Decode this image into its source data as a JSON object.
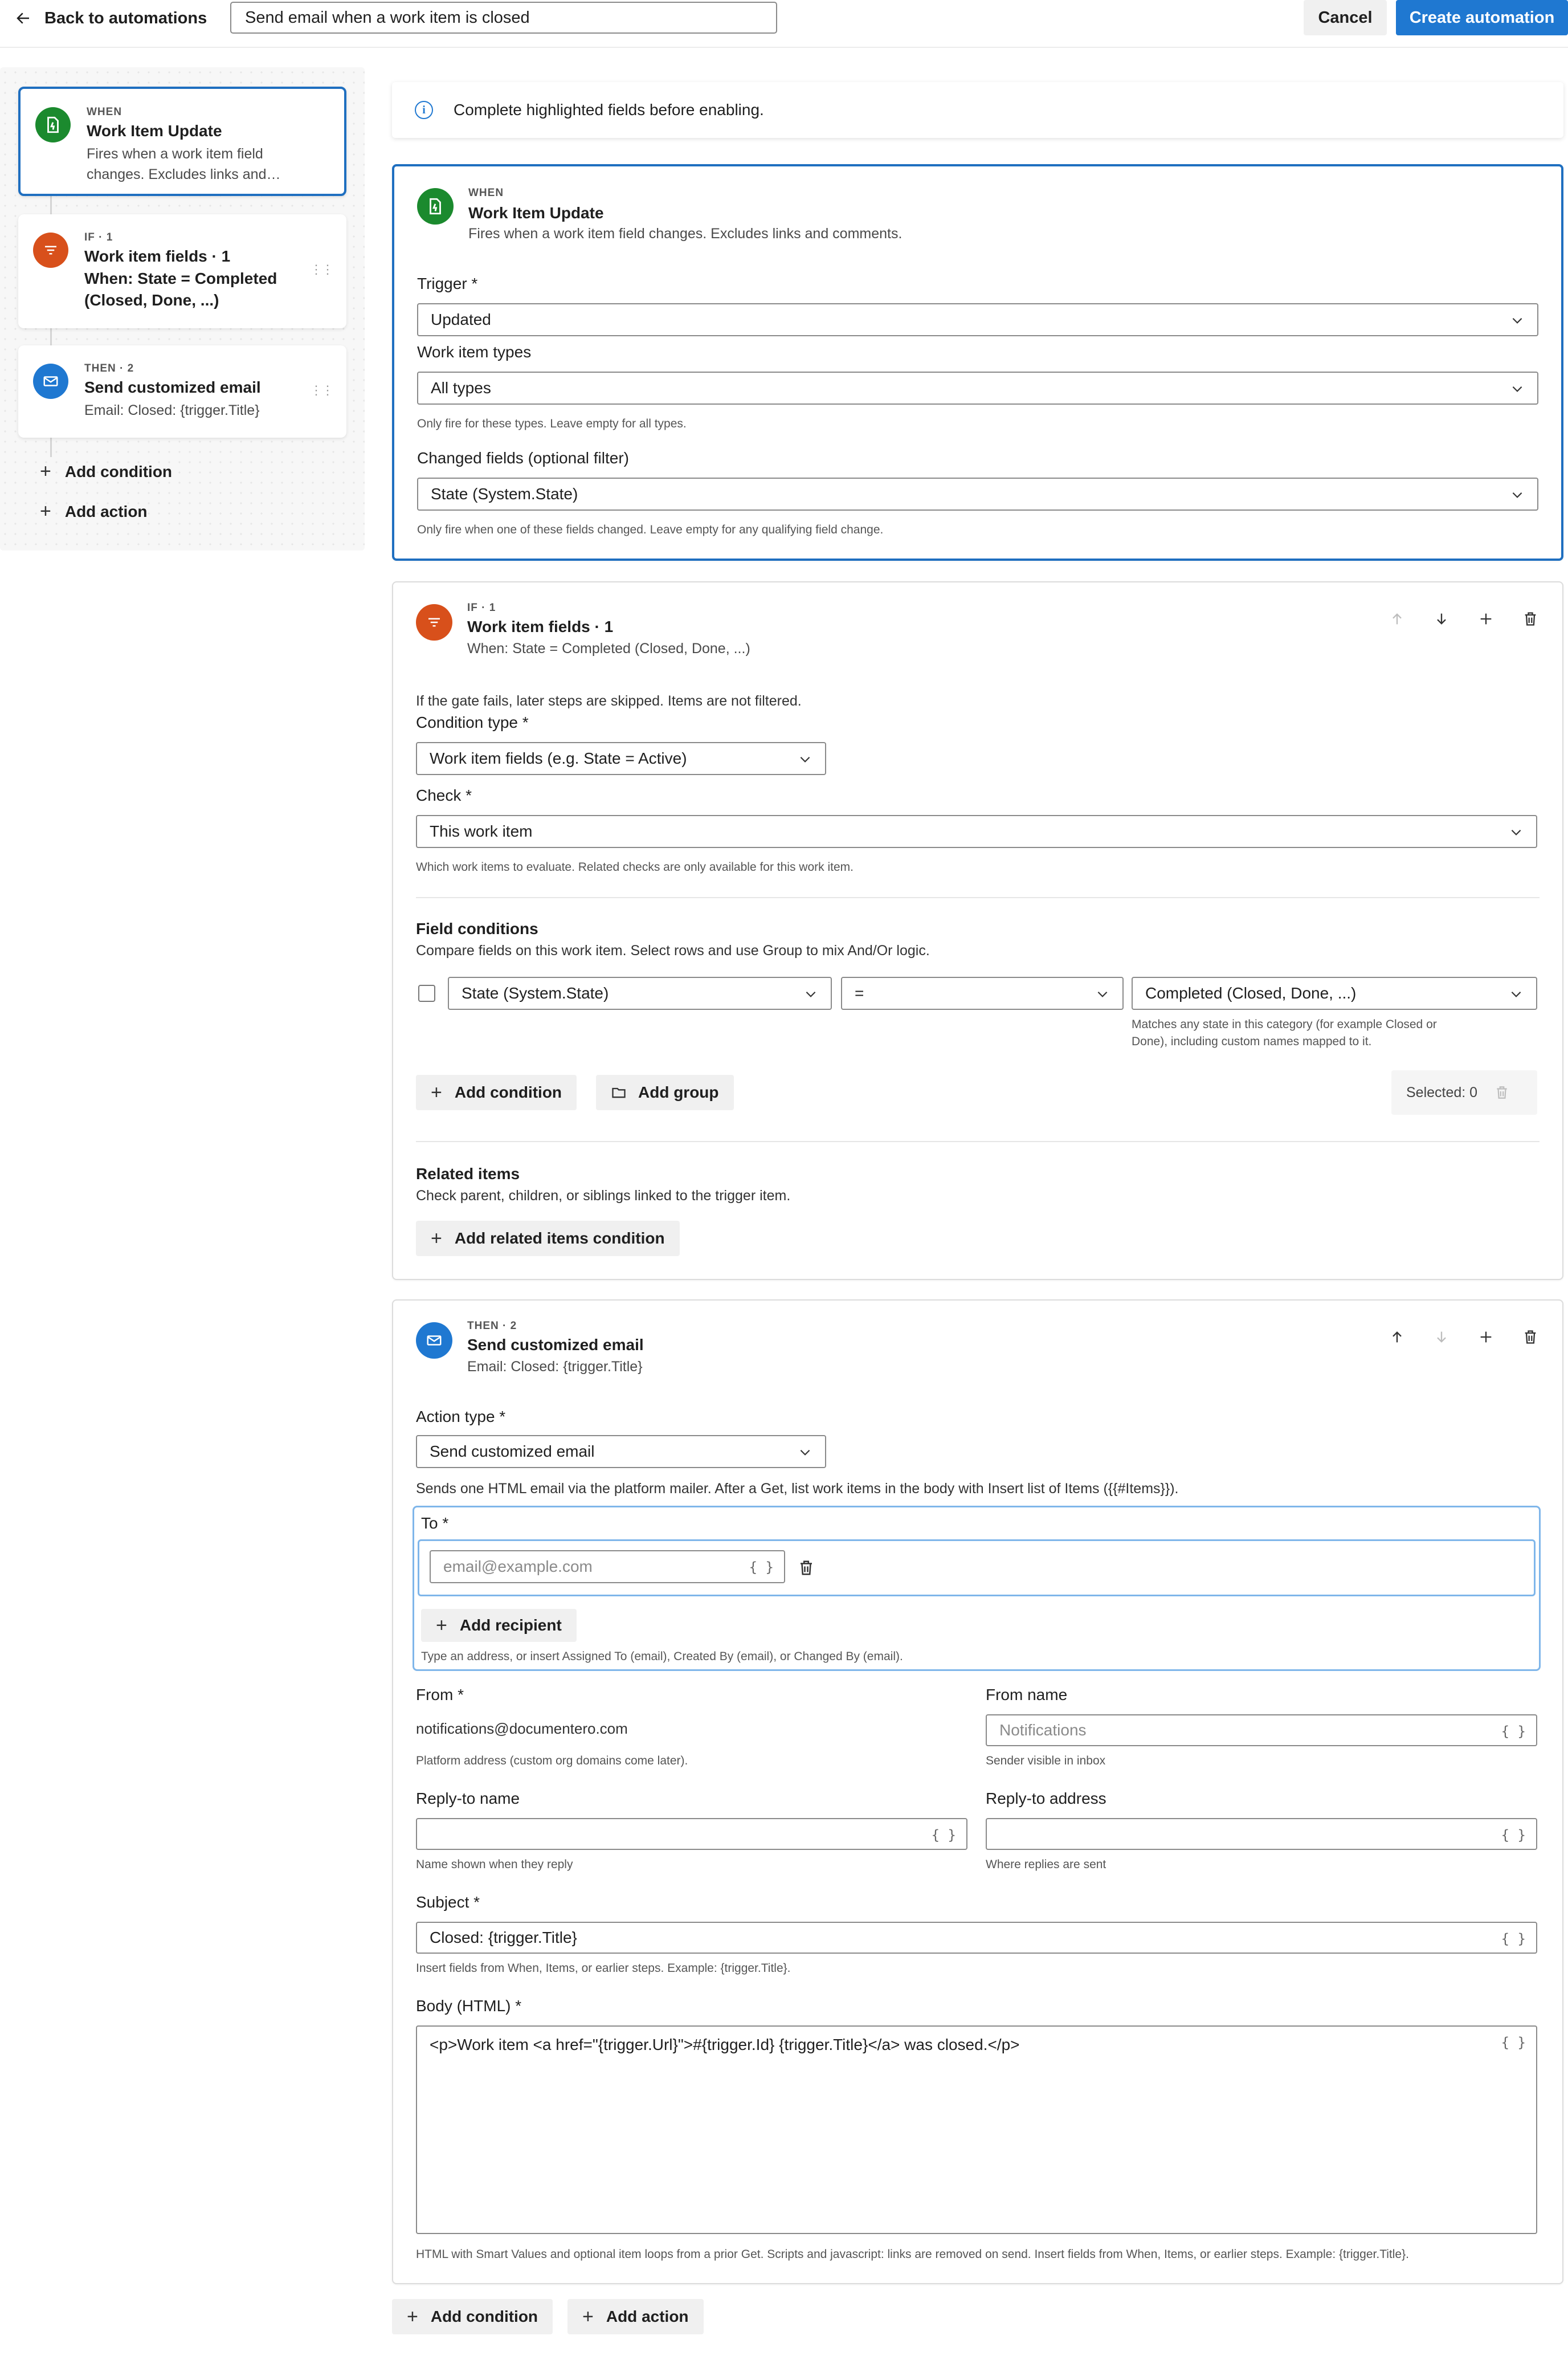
{
  "topbar": {
    "back_label": "Back to automations",
    "automation_name": "Send email when a work item is closed",
    "cancel_label": "Cancel",
    "create_label": "Create automation"
  },
  "rail": {
    "when_card": {
      "kicker": "WHEN",
      "title": "Work Item Update",
      "desc_line1": "Fires when a work item field",
      "desc_line2": "changes. Excludes links and…"
    },
    "if_card": {
      "kicker": "IF · 1",
      "title": "Work item fields · 1",
      "cond_line1": "When: State = Completed",
      "cond_line2": "(Closed, Done, ...)"
    },
    "then_card": {
      "kicker": "THEN · 2",
      "title": "Send customized email",
      "desc": "Email: Closed: {trigger.Title}"
    },
    "add_condition": "Add condition",
    "add_action": "Add action"
  },
  "banner": {
    "text": "Complete highlighted fields before enabling."
  },
  "when_section": {
    "kicker": "WHEN",
    "title": "Work Item Update",
    "desc": "Fires when a work item field changes. Excludes links and comments.",
    "trigger_label": "Trigger *",
    "trigger_value": "Updated",
    "types_label": "Work item types",
    "types_value": "All types",
    "types_help": "Only fire for these types. Leave empty for all types.",
    "changed_label": "Changed fields (optional filter)",
    "changed_value": "State (System.State)",
    "changed_help": "Only fire when one of these fields changed. Leave empty for any qualifying field change."
  },
  "if_section": {
    "kicker": "IF · 1",
    "title": "Work item fields · 1",
    "desc": "When: State = Completed (Closed, Done, ...)",
    "gate_note": "If the gate fails, later steps are skipped. Items are not filtered.",
    "condition_type_label": "Condition type *",
    "condition_type_value": "Work item fields (e.g. State = Active)",
    "check_label": "Check *",
    "check_value": "This work item",
    "check_help": "Which work items to evaluate. Related checks are only available for this work item.",
    "field_conditions_title": "Field conditions",
    "field_conditions_desc": "Compare fields on this work item. Select rows and use Group to mix And/Or logic.",
    "row_field": "State (System.State)",
    "row_operator": "=",
    "row_value": "Completed (Closed, Done, ...)",
    "row_help_line1": "Matches any state in this category (for example Closed or",
    "row_help_line2": "Done), including custom names mapped to it.",
    "add_condition": "Add condition",
    "add_group": "Add group",
    "selected": "Selected: 0",
    "related_title": "Related items",
    "related_desc": "Check parent, children, or siblings linked to the trigger item.",
    "add_related": "Add related items condition"
  },
  "then_section": {
    "kicker": "THEN · 2",
    "title": "Send customized email",
    "desc": "Email: Closed: {trigger.Title}",
    "action_type_label": "Action type *",
    "action_type_value": "Send customized email",
    "action_desc": "Sends one HTML email via the platform mailer. After a Get, list work items in the body with Insert list of Items ({{#Items}}).",
    "to_label": "To *",
    "to_placeholder": "email@example.com",
    "add_recipient": "Add recipient",
    "to_help": "Type an address, or insert Assigned To (email), Created By (email), or Changed By (email).",
    "from_label": "From *",
    "from_value": "notifications@documentero.com",
    "from_help": "Platform address (custom org domains come later).",
    "from_name_label": "From name",
    "from_name_placeholder": "Notifications",
    "from_name_help": "Sender visible in inbox",
    "reply_name_label": "Reply-to name",
    "reply_name_help": "Name shown when they reply",
    "reply_addr_label": "Reply-to address",
    "reply_addr_help": "Where replies are sent",
    "subject_label": "Subject *",
    "subject_value": "Closed: {trigger.Title}",
    "subject_help": "Insert fields from When, Items, or earlier steps. Example: {trigger.Title}.",
    "body_label": "Body (HTML) *",
    "body_value": "<p>Work item <a href=\"{trigger.Url}\">#{trigger.Id} {trigger.Title}</a> was closed.</p>",
    "body_help": "HTML with Smart Values and optional item loops from a prior Get. Scripts and javascript: links are removed on send. Insert fields from When, Items, or earlier steps. Example: {trigger.Title}.",
    "curly": "{ }"
  },
  "footer": {
    "add_condition": "Add condition",
    "add_action": "Add action"
  },
  "colors": {
    "accent": "#1f78d1",
    "active_border": "#1f6fc0",
    "when_icon": "#1b8a2e",
    "if_icon": "#d8501b",
    "then_icon": "#1f78d1"
  },
  "icons": [
    "arrow-left-icon",
    "bolt-doc-icon",
    "filter-icon",
    "mail-icon",
    "info-icon",
    "arrow-up-icon",
    "arrow-down-icon",
    "plus-icon",
    "trash-icon",
    "chevron-down-icon",
    "folder-icon",
    "drag-handle-icon",
    "curly-braces-icon"
  ]
}
